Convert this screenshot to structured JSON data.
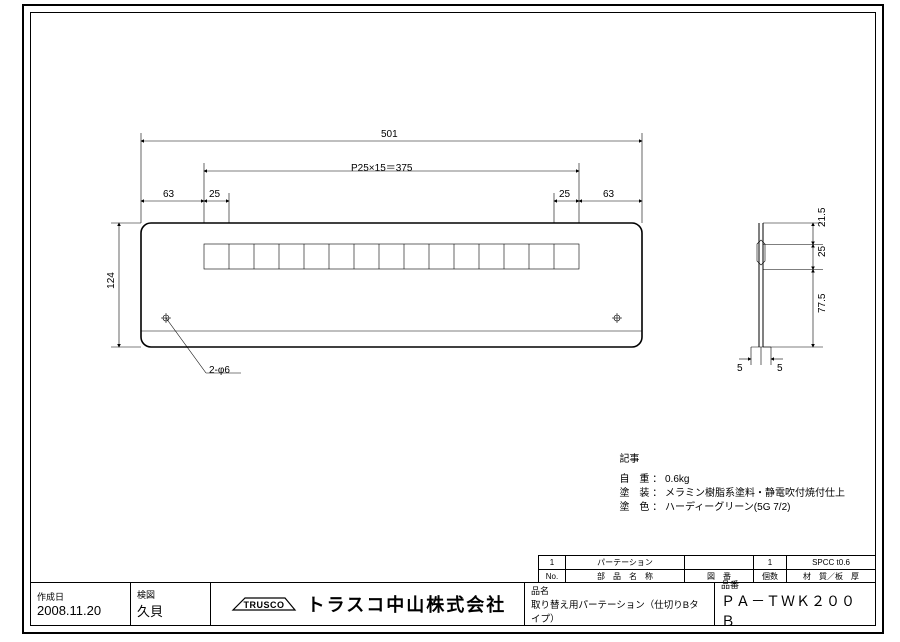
{
  "dims": {
    "overall_width": "501",
    "pitch": "P25×15＝375",
    "margin_left": "63",
    "inner_25_left": "25",
    "inner_25_right": "25",
    "margin_right": "63",
    "height": "124",
    "hole_note": "2-φ6",
    "side_21_5": "21.5",
    "side_25": "25",
    "side_77_5": "77.5",
    "side_5a": "5",
    "side_5b": "5"
  },
  "notes": {
    "header": "記事",
    "weight_label": "自　重 ：",
    "weight_value": "0.6kg",
    "finish_label": "塗　装 ：",
    "finish_value": "メラミン樹脂系塗料・静電吹付焼付仕上",
    "color_label": "塗　色 ：",
    "color_value": "ハーディーグリーン(5G 7/2)"
  },
  "parts_table": {
    "row": {
      "no": "1",
      "name": "パーテーション",
      "qty": "1",
      "material": "SPCC t0.6"
    },
    "head": {
      "no": "No.",
      "name": "部　品　名　称",
      "dwg": "図　番",
      "qty": "個数",
      "material": "材　質／板　厚"
    }
  },
  "titleblock": {
    "created_label": "作成日",
    "created_value": "2008.11.20",
    "check_label": "検図",
    "check_value": "久貝",
    "company": "トラスコ中山株式会社",
    "product_label": "品名",
    "product_value": "取り替え用パーテーション（仕切りBタイプ）",
    "partno_label": "品番",
    "partno_value": "ＰＡ－ＴＷＫ２００Ｂ"
  },
  "logo": "TRUSCO"
}
